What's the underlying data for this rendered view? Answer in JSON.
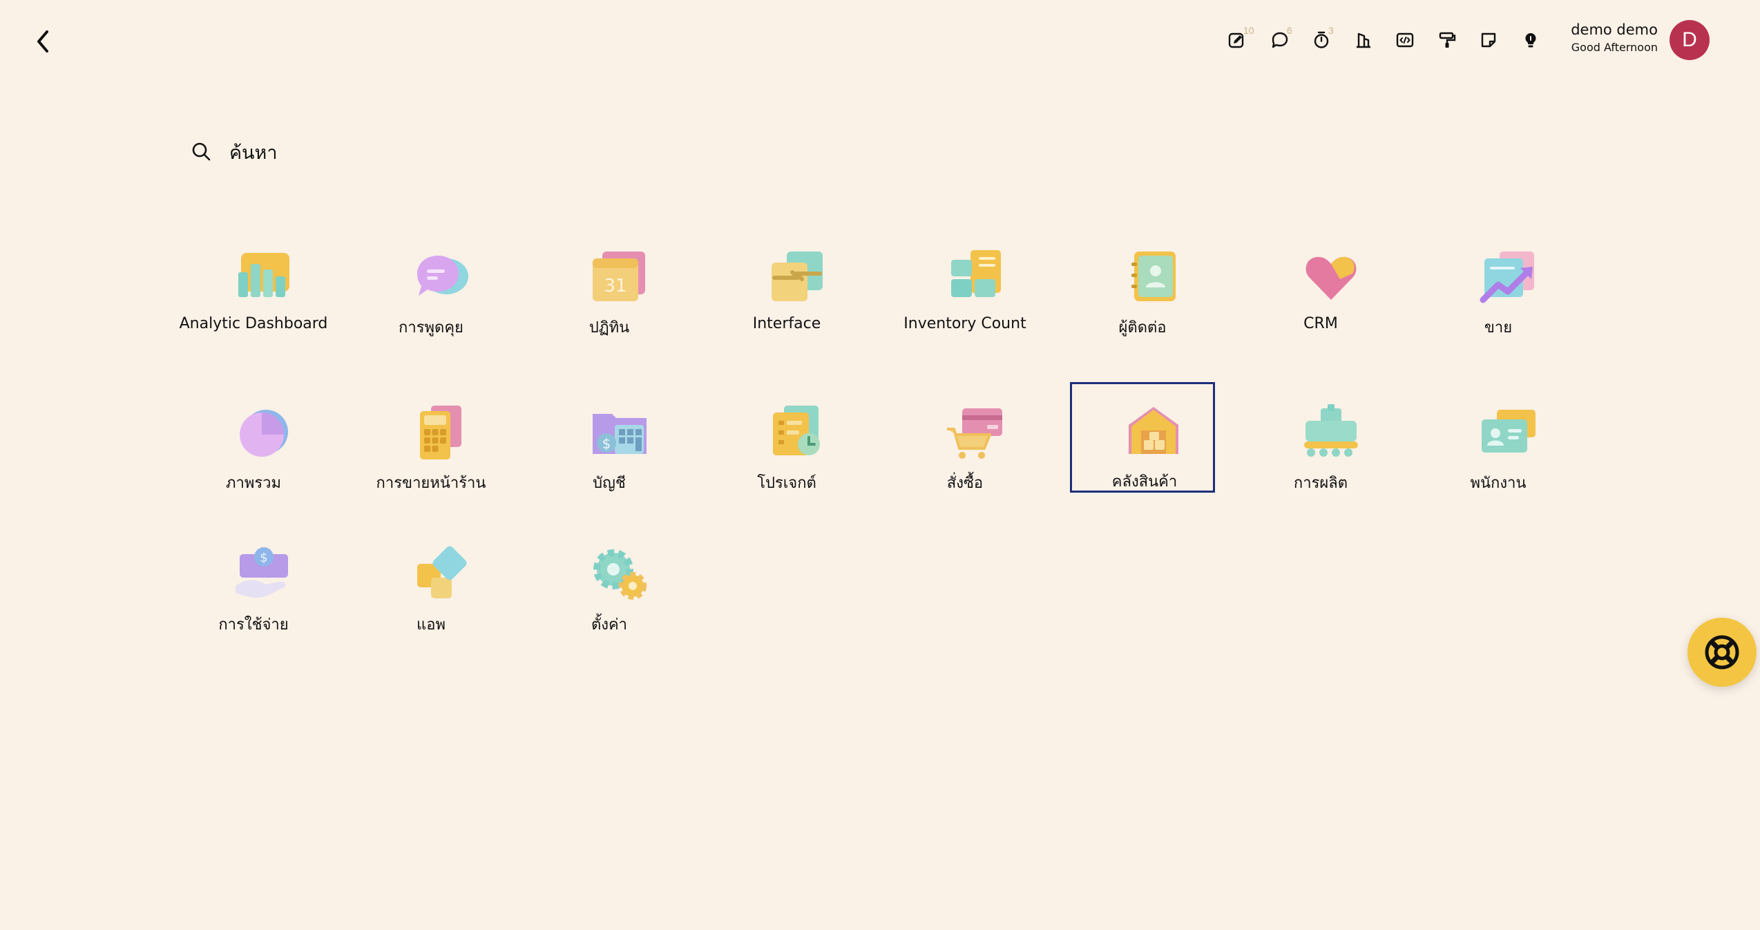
{
  "header": {
    "tools": [
      {
        "name": "activity-icon",
        "badge": "10"
      },
      {
        "name": "chat-icon",
        "badge": "6"
      },
      {
        "name": "timer-icon",
        "badge": "3"
      },
      {
        "name": "company-icon",
        "badge": ""
      },
      {
        "name": "code-icon",
        "badge": ""
      },
      {
        "name": "paint-roller-icon",
        "badge": ""
      },
      {
        "name": "sticky-note-icon",
        "badge": ""
      },
      {
        "name": "lightbulb-icon",
        "badge": ""
      }
    ],
    "user": {
      "name": "demo demo",
      "greeting": "Good Afternoon",
      "avatar_letter": "D",
      "avatar_color": "#b8324f"
    }
  },
  "search": {
    "placeholder": "ค้นหา"
  },
  "apps": [
    {
      "label": "Analytic Dashboard",
      "icon": "dashboard-icon"
    },
    {
      "label": "การพูดคุย",
      "icon": "discuss-icon"
    },
    {
      "label": "ปฏิทิน",
      "icon": "calendar-icon",
      "icon_text": "31"
    },
    {
      "label": "Interface",
      "icon": "interface-icon"
    },
    {
      "label": "Inventory Count",
      "icon": "inventory-count-icon"
    },
    {
      "label": "ผู้ติดต่อ",
      "icon": "contacts-icon"
    },
    {
      "label": "CRM",
      "icon": "crm-icon"
    },
    {
      "label": "ขาย",
      "icon": "sales-icon"
    },
    {
      "label": "ภาพรวม",
      "icon": "overview-icon"
    },
    {
      "label": "การขายหน้าร้าน",
      "icon": "point-of-sale-icon"
    },
    {
      "label": "บัญชี",
      "icon": "accounting-icon"
    },
    {
      "label": "โปรเจกต์",
      "icon": "project-icon"
    },
    {
      "label": "สั่งซื้อ",
      "icon": "purchase-icon"
    },
    {
      "label": "คลังสินค้า",
      "icon": "inventory-icon",
      "selected": true
    },
    {
      "label": "การผลิต",
      "icon": "manufacturing-icon"
    },
    {
      "label": "พนักงาน",
      "icon": "employees-icon"
    },
    {
      "label": "การใช้จ่าย",
      "icon": "expenses-icon"
    },
    {
      "label": "แอพ",
      "icon": "apps-icon"
    },
    {
      "label": "ตั้งค่า",
      "icon": "settings-icon"
    }
  ],
  "colors": {
    "background": "#faf1e7",
    "selection_border": "#1d2e7a",
    "help_button": "#f4c542"
  }
}
